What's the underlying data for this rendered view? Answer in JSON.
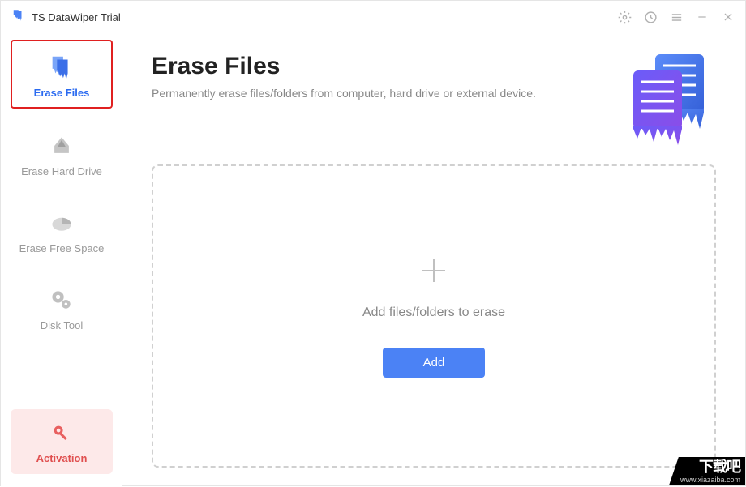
{
  "titlebar": {
    "app_title": "TS DataWiper Trial"
  },
  "sidebar": {
    "items": [
      {
        "label": "Erase Files",
        "active": true
      },
      {
        "label": "Erase Hard Drive",
        "active": false
      },
      {
        "label": "Erase Free Space",
        "active": false
      },
      {
        "label": "Disk Tool",
        "active": false
      }
    ],
    "activation_label": "Activation"
  },
  "main": {
    "title": "Erase Files",
    "subtitle": "Permanently erase files/folders from computer, hard drive or external device.",
    "dropzone_text": "Add files/folders to erase",
    "add_button_label": "Add"
  },
  "watermark": {
    "line1": "下载吧",
    "line2": "www.xiazaiba.com"
  },
  "colors": {
    "accent": "#4b82f5",
    "active_border": "#e02020",
    "activation_bg": "#fde9e9",
    "activation_text": "#e05050"
  }
}
